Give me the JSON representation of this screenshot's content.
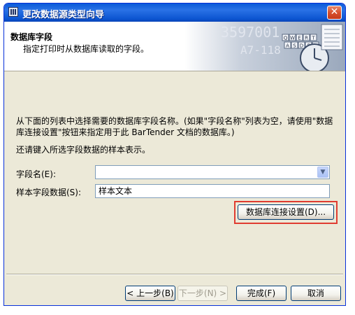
{
  "window": {
    "title": "更改数据源类型向导"
  },
  "header": {
    "title": "数据库字段",
    "subtitle": "指定打印时从数据库读取的字段。",
    "art_text": [
      "3597001",
      "A7-118"
    ],
    "keyboard_keys": [
      "Q",
      "W",
      "E",
      "R",
      "T",
      "A",
      "S",
      "D",
      "F",
      "G"
    ]
  },
  "body": {
    "instruction": "从下面的列表中选择需要的数据库字段名称。(如果\"字段名称\"列表为空，请使用\"数据库连接设置\"按钮来指定用于此 BarTender 文档的数据库。)",
    "sample_instruction": "还请键入所选字段数据的样本表示。",
    "field_name_label": "字段名(E):",
    "field_name_value": "",
    "sample_label": "样本字段数据(S):",
    "sample_value": "样本文本",
    "db_settings_button": "数据库连接设置(D)..."
  },
  "footer": {
    "back": "< 上一步(B)",
    "next": "下一步(N) >",
    "finish": "完成(F)",
    "cancel": "取消"
  },
  "colors": {
    "titlebar": "#0a5ad8",
    "highlight": "#e03c31",
    "dialog_bg": "#ece9d8"
  }
}
